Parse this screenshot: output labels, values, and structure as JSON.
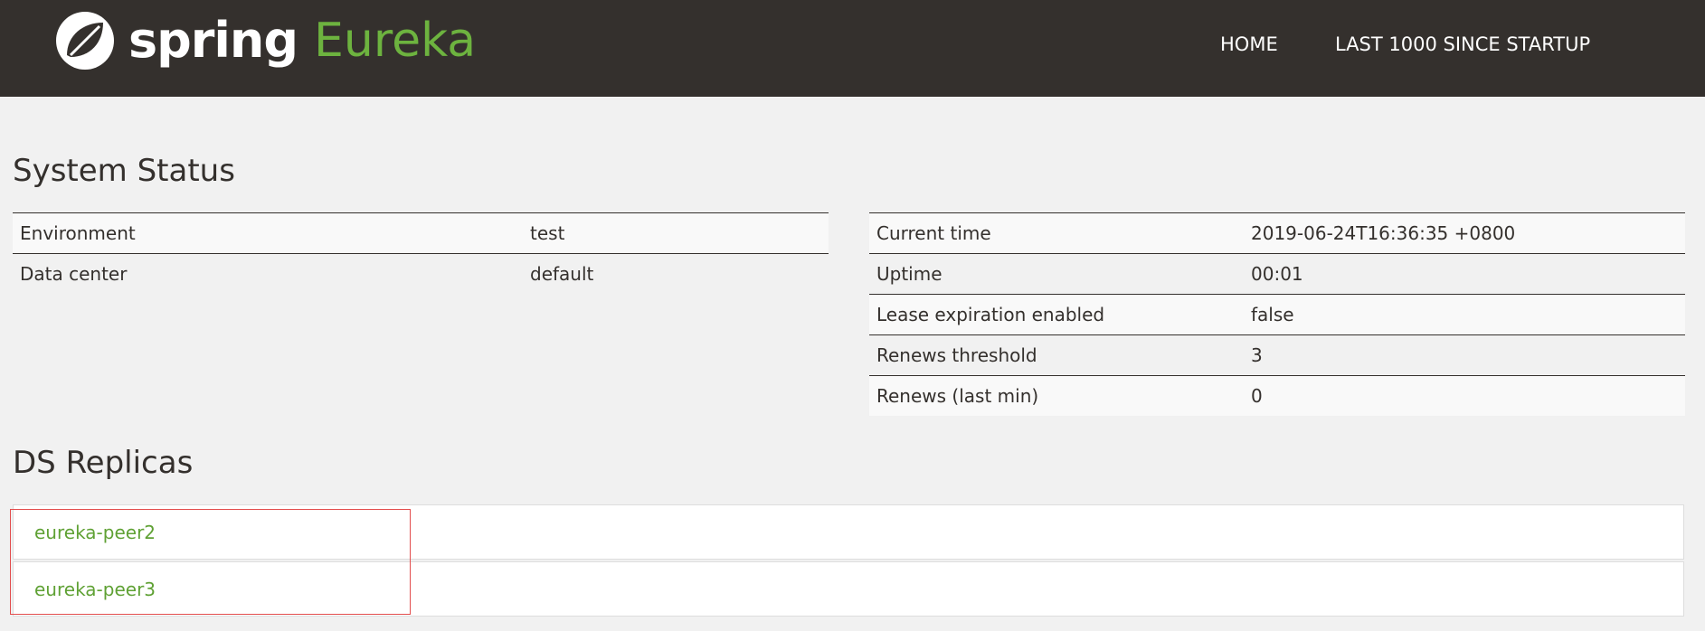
{
  "header": {
    "brand_word_spring": "spring",
    "brand_word_eureka": "Eureka",
    "logo_icon": "spring-leaf-icon",
    "nav": [
      {
        "label": "HOME"
      },
      {
        "label": "LAST 1000 SINCE STARTUP"
      }
    ]
  },
  "system_status": {
    "title": "System Status",
    "left_table": [
      {
        "key": "Environment",
        "value": "test"
      },
      {
        "key": "Data center",
        "value": "default"
      }
    ],
    "right_table": [
      {
        "key": "Current time",
        "value": "2019-06-24T16:36:35 +0800"
      },
      {
        "key": "Uptime",
        "value": "00:01"
      },
      {
        "key": "Lease expiration enabled",
        "value": "false"
      },
      {
        "key": "Renews threshold",
        "value": "3"
      },
      {
        "key": "Renews (last min)",
        "value": "0"
      }
    ]
  },
  "ds_replicas": {
    "title": "DS Replicas",
    "items": [
      {
        "label": "eureka-peer2"
      },
      {
        "label": "eureka-peer3"
      }
    ]
  },
  "colors": {
    "nav_background": "#34302d",
    "brand_green": "#6db33f",
    "link_green": "#5fa134",
    "highlight_red": "#e34d4d"
  }
}
